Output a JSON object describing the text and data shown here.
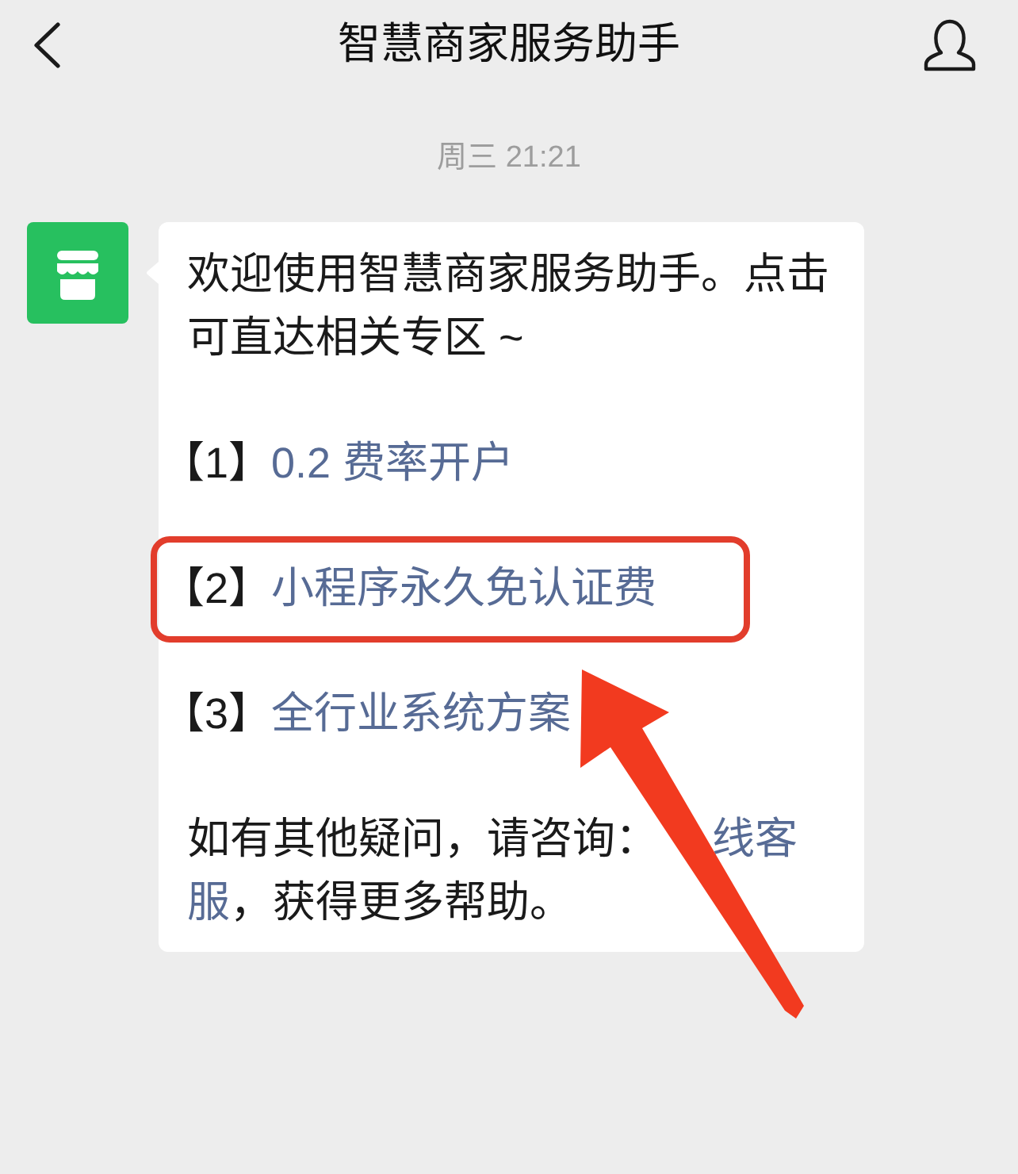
{
  "header": {
    "title": "智慧商家服务助手"
  },
  "timestamp": "周三 21:21",
  "message": {
    "intro": "欢迎使用智慧商家服务助手。点击可直达相关专区 ~",
    "options": [
      {
        "number": "【1】",
        "label": "0.2 费率开户",
        "highlighted": false
      },
      {
        "number": "【2】",
        "label": "小程序永久免认证费",
        "highlighted": true
      },
      {
        "number": "【3】",
        "label": "全行业系统方案",
        "highlighted": false
      }
    ],
    "help": [
      {
        "kind": "text",
        "text": "如有其他疑问，请咨询："
      },
      {
        "kind": "link",
        "text": "线客"
      },
      {
        "kind": "link",
        "text": "服"
      },
      {
        "kind": "text",
        "text": "，获得更多帮助。"
      }
    ]
  }
}
